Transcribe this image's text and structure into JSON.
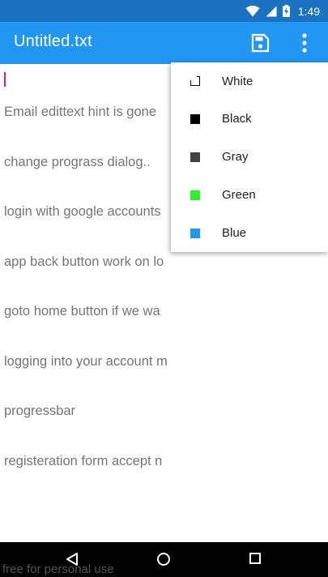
{
  "status_bar": {
    "time": "1:49",
    "icons": [
      "wifi-icon",
      "signal-icon",
      "battery-charging-icon"
    ]
  },
  "app_bar": {
    "title": "Untitled.txt",
    "save_icon": "save-icon",
    "overflow_icon": "more-vert-icon"
  },
  "editor": {
    "lines": [
      "Email edittext hint is gone",
      "change prograss dialog..",
      "login with google accounts",
      "app back button work on lo",
      "goto home button if we wa",
      "logging into your account m",
      "progressbar",
      "registeration form accept n"
    ]
  },
  "color_menu": {
    "items": [
      {
        "label": "White",
        "color": "#ffffff"
      },
      {
        "label": "Black",
        "color": "#000000"
      },
      {
        "label": "Gray",
        "color": "#424242"
      },
      {
        "label": "Green",
        "color": "#2af32a"
      },
      {
        "label": "Blue",
        "color": "#2196f3"
      }
    ]
  },
  "nav_bar": {
    "icons": [
      "back-icon",
      "home-icon",
      "recents-icon"
    ]
  },
  "watermark": "free for personal use"
}
